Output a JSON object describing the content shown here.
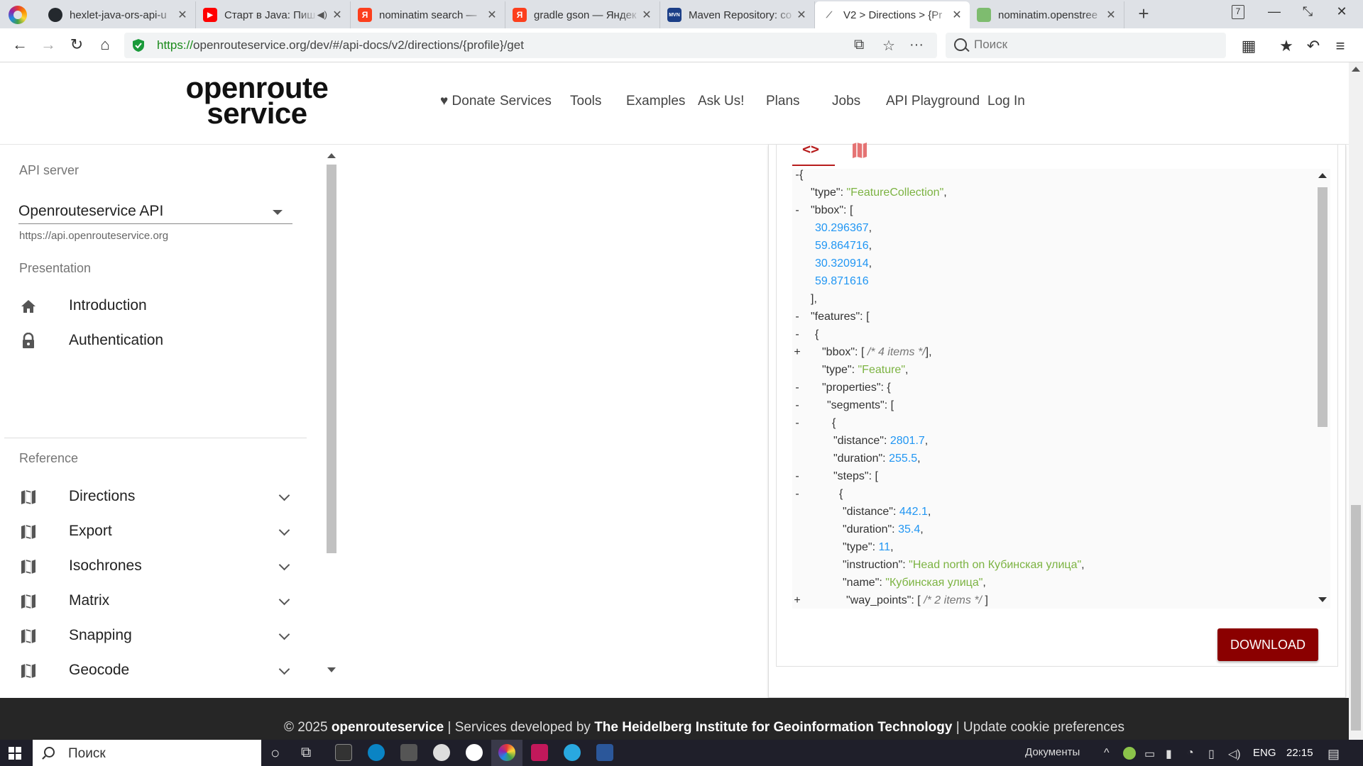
{
  "browser": {
    "tabs": [
      {
        "title": "hexlet-java-ors-api-u",
        "favicon_color": "#24292e",
        "favicon_glyph": "github-icon",
        "active": false
      },
      {
        "title": "Старт в Java: Пиш",
        "favicon_color": "#ff0000",
        "favicon_glyph": "youtube-icon",
        "active": false,
        "audio": true
      },
      {
        "title": "nominatim search —",
        "favicon_color": "#fc3f1d",
        "favicon_glyph": "Я",
        "active": false
      },
      {
        "title": "gradle gson — Яндек",
        "favicon_color": "#fc3f1d",
        "favicon_glyph": "Я",
        "active": false
      },
      {
        "title": "Maven Repository: co",
        "favicon_color": "#1b3e87",
        "favicon_glyph": "MVN",
        "active": false
      },
      {
        "title": "V2 > Directions > {Pr",
        "favicon_color": "#ffffff",
        "favicon_glyph": "route-icon",
        "active": true
      },
      {
        "title": "nominatim.openstree",
        "favicon_color": "#7ebc6f",
        "favicon_glyph": "osm-icon",
        "active": false
      }
    ],
    "tab_count": "7",
    "url": {
      "scheme": "https://",
      "rest": "openrouteservice.org/dev/#/api-docs/v2/directions/{profile}/get"
    },
    "search_placeholder": "Поиск"
  },
  "site": {
    "logo_line1": "openroute",
    "logo_line2": "service",
    "nav": [
      {
        "label": "♥ Donate"
      },
      {
        "label": "Services"
      },
      {
        "label": "Tools"
      },
      {
        "label": "Examples"
      },
      {
        "label": "Ask Us!"
      },
      {
        "label": "Plans"
      },
      {
        "label": "Jobs"
      },
      {
        "label": "API Playground"
      },
      {
        "label": "Log In"
      }
    ]
  },
  "sidebar": {
    "api_server_label": "API server",
    "api_server_value": "Openrouteservice API",
    "api_server_url": "https://api.openrouteservice.org",
    "presentation_label": "Presentation",
    "presentation_items": [
      {
        "label": "Introduction",
        "icon": "home-icon"
      },
      {
        "label": "Authentication",
        "icon": "lock-icon"
      }
    ],
    "reference_label": "Reference",
    "reference_items": [
      {
        "label": "Directions",
        "icon": "map-icon"
      },
      {
        "label": "Export",
        "icon": "map-icon"
      },
      {
        "label": "Isochrones",
        "icon": "map-icon"
      },
      {
        "label": "Matrix",
        "icon": "map-icon"
      },
      {
        "label": "Snapping",
        "icon": "map-icon"
      },
      {
        "label": "Geocode",
        "icon": "map-icon"
      }
    ]
  },
  "response": {
    "download_label": "DOWNLOAD",
    "json_lines": [
      {
        "toggle": "-",
        "indent": 0,
        "parts": [
          {
            "t": "p",
            "v": "{"
          }
        ]
      },
      {
        "toggle": "",
        "indent": 1,
        "parts": [
          {
            "t": "k",
            "v": "\"type\": "
          },
          {
            "t": "s",
            "v": "\"FeatureCollection\""
          },
          {
            "t": "p",
            "v": ","
          }
        ]
      },
      {
        "toggle": "-",
        "indent": 1,
        "parts": [
          {
            "t": "k",
            "v": "\"bbox\": ["
          }
        ]
      },
      {
        "toggle": "",
        "indent": 2,
        "parts": [
          {
            "t": "n",
            "v": "30.296367"
          },
          {
            "t": "p",
            "v": ","
          }
        ]
      },
      {
        "toggle": "",
        "indent": 2,
        "parts": [
          {
            "t": "n",
            "v": "59.864716"
          },
          {
            "t": "p",
            "v": ","
          }
        ]
      },
      {
        "toggle": "",
        "indent": 2,
        "parts": [
          {
            "t": "n",
            "v": "30.320914"
          },
          {
            "t": "p",
            "v": ","
          }
        ]
      },
      {
        "toggle": "",
        "indent": 2,
        "parts": [
          {
            "t": "n",
            "v": "59.871616"
          }
        ]
      },
      {
        "toggle": "",
        "indent": 1,
        "parts": [
          {
            "t": "p",
            "v": "],"
          }
        ]
      },
      {
        "toggle": "-",
        "indent": 1,
        "parts": [
          {
            "t": "k",
            "v": "\"features\": ["
          }
        ]
      },
      {
        "toggle": "-",
        "indent": 2,
        "parts": [
          {
            "t": "p",
            "v": "{"
          }
        ]
      },
      {
        "toggle": "+",
        "indent": 3,
        "parts": [
          {
            "t": "k",
            "v": "\"bbox\": [ "
          },
          {
            "t": "c",
            "v": "/* 4 items */"
          },
          {
            "t": "p",
            "v": "],"
          }
        ]
      },
      {
        "toggle": "",
        "indent": 3,
        "parts": [
          {
            "t": "k",
            "v": "\"type\": "
          },
          {
            "t": "s",
            "v": "\"Feature\""
          },
          {
            "t": "p",
            "v": ","
          }
        ]
      },
      {
        "toggle": "-",
        "indent": 3,
        "parts": [
          {
            "t": "k",
            "v": "\"properties\": {"
          }
        ]
      },
      {
        "toggle": "-",
        "indent": 4,
        "parts": [
          {
            "t": "k",
            "v": "\"segments\": ["
          }
        ]
      },
      {
        "toggle": "-",
        "indent": 5,
        "parts": [
          {
            "t": "p",
            "v": "{"
          }
        ]
      },
      {
        "toggle": "",
        "indent": 6,
        "parts": [
          {
            "t": "k",
            "v": "\"distance\": "
          },
          {
            "t": "n",
            "v": "2801.7"
          },
          {
            "t": "p",
            "v": ","
          }
        ]
      },
      {
        "toggle": "",
        "indent": 6,
        "parts": [
          {
            "t": "k",
            "v": "\"duration\": "
          },
          {
            "t": "n",
            "v": "255.5"
          },
          {
            "t": "p",
            "v": ","
          }
        ]
      },
      {
        "toggle": "-",
        "indent": 6,
        "parts": [
          {
            "t": "k",
            "v": "\"steps\": ["
          }
        ]
      },
      {
        "toggle": "-",
        "indent": 7,
        "parts": [
          {
            "t": "p",
            "v": "{"
          }
        ]
      },
      {
        "toggle": "",
        "indent": 8,
        "parts": [
          {
            "t": "k",
            "v": "\"distance\": "
          },
          {
            "t": "n",
            "v": "442.1"
          },
          {
            "t": "p",
            "v": ","
          }
        ]
      },
      {
        "toggle": "",
        "indent": 8,
        "parts": [
          {
            "t": "k",
            "v": "\"duration\": "
          },
          {
            "t": "n",
            "v": "35.4"
          },
          {
            "t": "p",
            "v": ","
          }
        ]
      },
      {
        "toggle": "",
        "indent": 8,
        "parts": [
          {
            "t": "k",
            "v": "\"type\": "
          },
          {
            "t": "n",
            "v": "11"
          },
          {
            "t": "p",
            "v": ","
          }
        ]
      },
      {
        "toggle": "",
        "indent": 8,
        "parts": [
          {
            "t": "k",
            "v": "\"instruction\": "
          },
          {
            "t": "s",
            "v": "\"Head north on Кубинская улица\""
          },
          {
            "t": "p",
            "v": ","
          }
        ]
      },
      {
        "toggle": "",
        "indent": 8,
        "parts": [
          {
            "t": "k",
            "v": "\"name\": "
          },
          {
            "t": "s",
            "v": "\"Кубинская улица\""
          },
          {
            "t": "p",
            "v": ","
          }
        ]
      },
      {
        "toggle": "+",
        "indent": 9,
        "parts": [
          {
            "t": "k",
            "v": "\"way_points\": [ "
          },
          {
            "t": "c",
            "v": "/* 2 items */"
          },
          {
            "t": "p",
            "v": " ]"
          }
        ]
      }
    ]
  },
  "footer": {
    "copyright": "© 2025 ",
    "brand": "openrouteservice",
    "sep1": " | Services developed by ",
    "institute": "The Heidelberg Institute for Geoinformation Technology",
    "sep2": " | ",
    "cookie_link": "Update cookie preferences"
  },
  "taskbar": {
    "search_placeholder": "Поиск",
    "tray_folder": "Документы",
    "lang": "ENG",
    "time": "22:15"
  },
  "colors": {
    "accent": "#8b0000",
    "json_string": "#7cb342",
    "json_number": "#2196f3",
    "footer_bg": "#262626"
  }
}
